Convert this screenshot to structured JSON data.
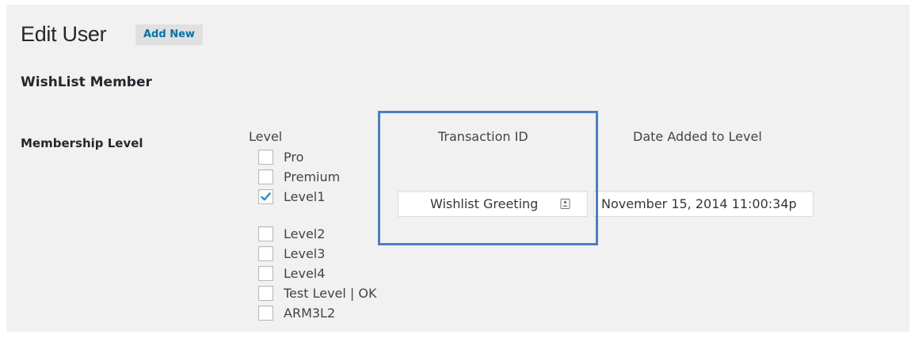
{
  "header": {
    "title": "Edit User",
    "add_new_label": "Add New"
  },
  "section": {
    "title": "WishList Member"
  },
  "membership": {
    "row_label": "Membership Level",
    "columns": {
      "level": "Level",
      "transaction_id": "Transaction ID",
      "date_added": "Date Added to Level"
    },
    "levels": [
      {
        "label": "Pro",
        "checked": false
      },
      {
        "label": "Premium",
        "checked": false
      },
      {
        "label": "Level1",
        "checked": true
      },
      {
        "label": "Level2",
        "checked": false
      },
      {
        "label": "Level3",
        "checked": false
      },
      {
        "label": "Level4",
        "checked": false
      },
      {
        "label": "Test Level | OK",
        "checked": false
      },
      {
        "label": "ARM3L2",
        "checked": false
      }
    ],
    "transaction_id_value": "Wishlist Greeting",
    "date_added_value": "November 15, 2014 11:00:34p"
  },
  "colors": {
    "accent": "#0073aa",
    "highlight_border": "#4a7fc1",
    "checkmark": "#1e8cbe"
  },
  "icons": {
    "transaction_field": "contact-card-icon",
    "checked": "checkmark-icon"
  }
}
